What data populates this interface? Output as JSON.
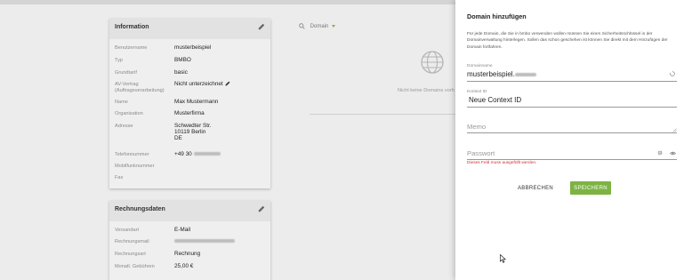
{
  "info_card": {
    "title": "Information",
    "rows": [
      {
        "label": "Benutzername",
        "value": "musterbeispiel"
      },
      {
        "label": "Typ",
        "value": "BMBO"
      },
      {
        "label": "Grundtarif",
        "value": "basic"
      },
      {
        "label": "AV-Vertrag\n(Auftragsverarbeitung)",
        "value": "Nicht unterzeichnet"
      },
      {
        "label": "Name",
        "value": "Max Mustermann"
      },
      {
        "label": "Organisation",
        "value": "Musterfirma"
      },
      {
        "label": "Adresse",
        "value": "Schwedter Str.\n10119 Berlin\nDE"
      },
      {
        "label": "Telefonnummer",
        "value": "+49 30"
      },
      {
        "label": "Mobilfunknummer",
        "value": ""
      },
      {
        "label": "Fax",
        "value": ""
      }
    ]
  },
  "billing_card": {
    "title": "Rechnungsdaten",
    "rows": [
      {
        "label": "Versandart",
        "value": "E-Mail"
      },
      {
        "label": "Rechnungsmail",
        "value": ""
      },
      {
        "label": "Rechnungsart",
        "value": "Rechnung"
      },
      {
        "label": "Monatl. Gebühren",
        "value": "25,00 €"
      }
    ]
  },
  "domains": {
    "filter_label": "Domain",
    "empty_text": "Nicht keine Domains vorh"
  },
  "dialog": {
    "title": "Domain hinzufügen",
    "description": "Für jede Domain, die Sie in bmbo verwenden wollen müssen Sie einen Sicherheitsschlüssel in der Domainverwaltung hinterlegen. Sollen das schon geschehen ist können Sie direkt mit dem Hinzufügen der Domain fortfahren.",
    "domain_label": "Domainname",
    "domain_value": "musterbeispiel.",
    "context_label": "Kontext ID",
    "context_value": "Neue Context ID",
    "memo_placeholder": "Memo",
    "password_placeholder": "Passwort",
    "error_text": "Dieses Feld muss ausgefüllt werden.",
    "cancel_label": "ABBRECHEN",
    "save_label": "SPEICHERN"
  },
  "colors": {
    "accent": "#7cb342",
    "error": "#d32f2f"
  }
}
